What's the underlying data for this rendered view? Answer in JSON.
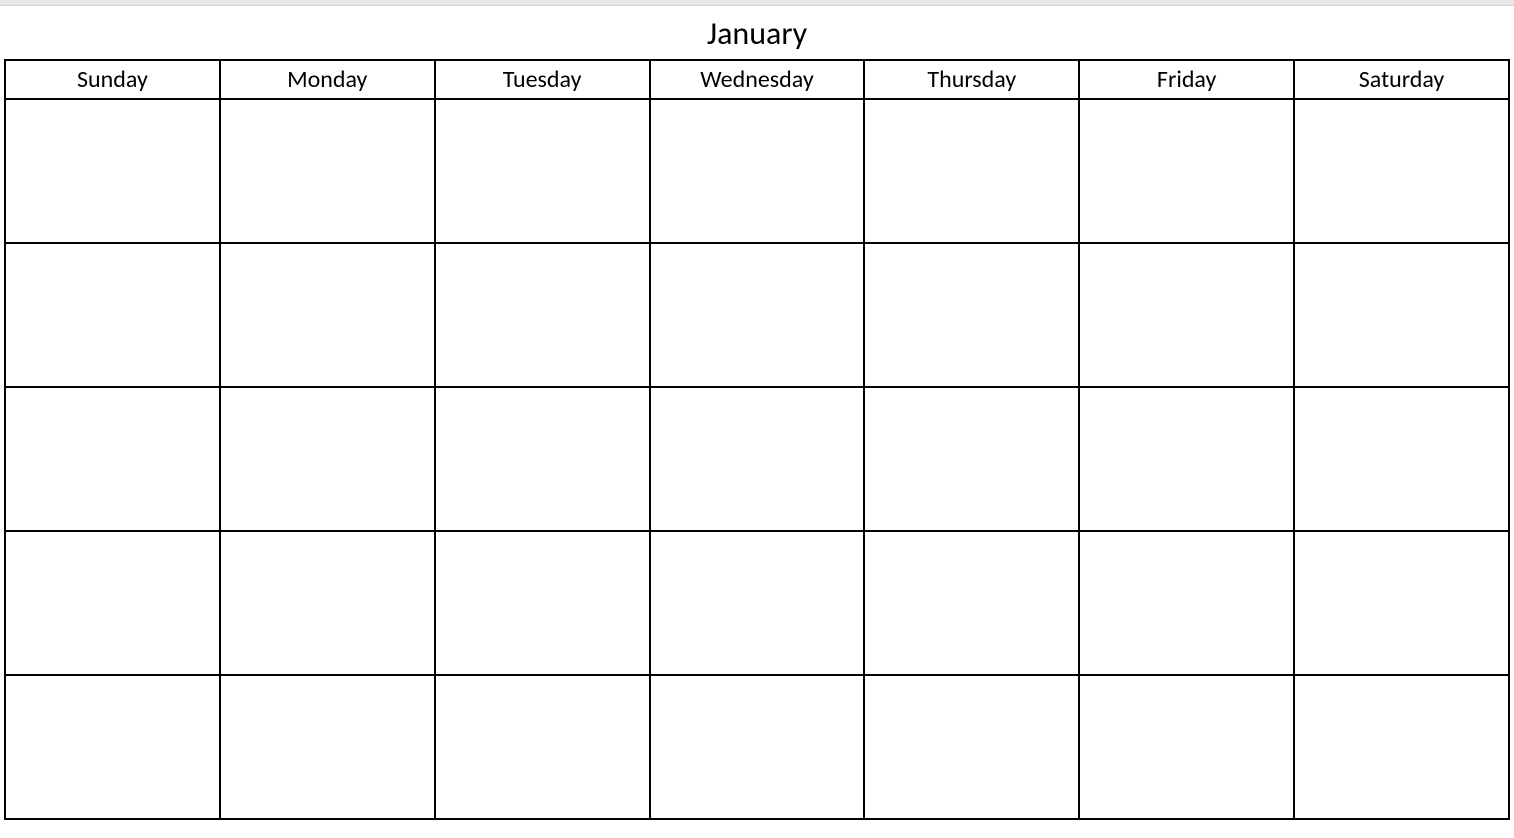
{
  "calendar": {
    "month": "January",
    "days": [
      "Sunday",
      "Monday",
      "Tuesday",
      "Wednesday",
      "Thursday",
      "Friday",
      "Saturday"
    ],
    "rows": 5,
    "cols": 7
  }
}
